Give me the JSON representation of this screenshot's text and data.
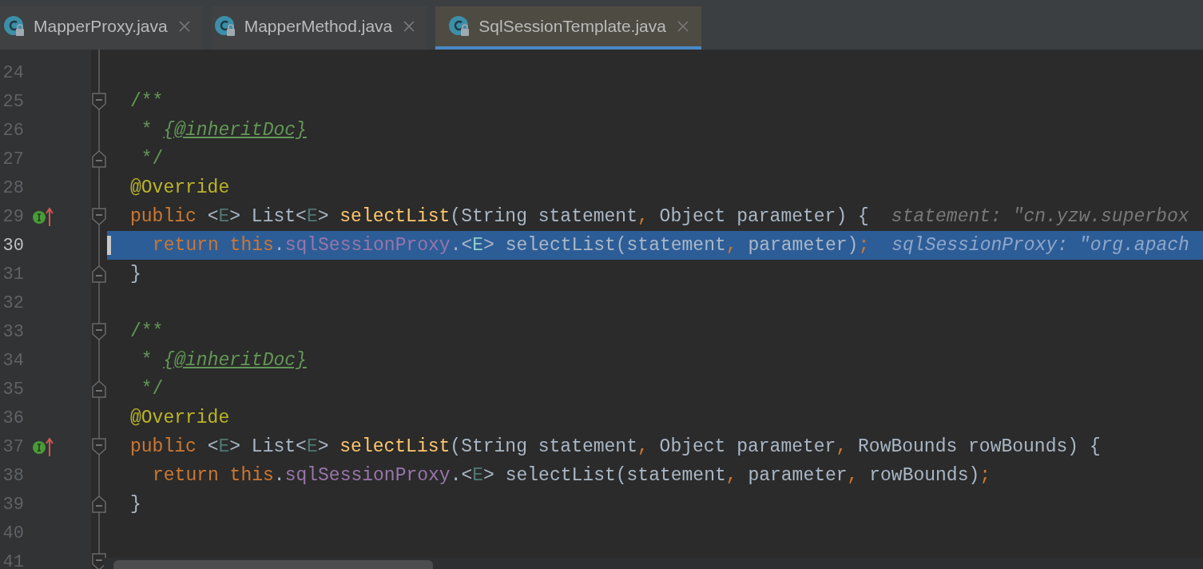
{
  "tabs": [
    {
      "label": "MapperProxy.java",
      "selected": false
    },
    {
      "label": "MapperMethod.java",
      "selected": false
    },
    {
      "label": "SqlSessionTemplate.java",
      "selected": true
    }
  ],
  "lines": [
    {
      "number": "24",
      "current": false,
      "overrides": false
    },
    {
      "number": "25",
      "current": false,
      "overrides": false,
      "fold": {
        "kind": "start"
      },
      "tokens": [
        {
          "kind": "comment",
          "text": "/**"
        }
      ]
    },
    {
      "number": "26",
      "current": false,
      "overrides": false,
      "tokens": [
        {
          "kind": "comment",
          "text": " * "
        },
        {
          "kind": "doc_tag",
          "text": "{@inheritDoc}"
        }
      ]
    },
    {
      "number": "27",
      "current": false,
      "overrides": false,
      "fold": {
        "kind": "end"
      },
      "tokens": [
        {
          "kind": "comment",
          "text": " */"
        }
      ]
    },
    {
      "number": "28",
      "current": false,
      "overrides": false,
      "tokens": [
        {
          "kind": "annotation",
          "text": "@Override"
        }
      ]
    },
    {
      "number": "29",
      "current": false,
      "overrides": true,
      "fold": {
        "kind": "start"
      },
      "tokens": [
        {
          "kind": "keyword",
          "text": "public"
        },
        {
          "kind": "plain",
          "text": " <"
        },
        {
          "kind": "type_param",
          "text": "E"
        },
        {
          "kind": "plain",
          "text": "> List<"
        },
        {
          "kind": "type_param",
          "text": "E"
        },
        {
          "kind": "plain",
          "text": "> "
        },
        {
          "kind": "method",
          "text": "selectList"
        },
        {
          "kind": "plain",
          "text": "(String statement"
        },
        {
          "kind": "keyword",
          "text": ","
        },
        {
          "kind": "plain",
          "text": " Object parameter) {"
        }
      ],
      "hint": "statement: \"cn.yzw.superbox"
    },
    {
      "number": "30",
      "current": true,
      "overrides": false,
      "indented": true,
      "tokens": [
        {
          "kind": "keyword",
          "text": "return this"
        },
        {
          "kind": "plain",
          "text": "."
        },
        {
          "kind": "field",
          "text": "sqlSessionProxy"
        },
        {
          "kind": "plain",
          "text": ".<"
        },
        {
          "kind": "type_param",
          "text": "E"
        },
        {
          "kind": "plain",
          "text": "> selectList(statement"
        },
        {
          "kind": "keyword",
          "text": ","
        },
        {
          "kind": "plain",
          "text": " parameter)"
        },
        {
          "kind": "keyword",
          "text": ";"
        }
      ],
      "hint": "sqlSessionProxy: \"org.apach"
    },
    {
      "number": "31",
      "current": false,
      "overrides": false,
      "fold": {
        "kind": "end"
      },
      "tokens": [
        {
          "kind": "plain",
          "text": "}"
        }
      ]
    },
    {
      "number": "32",
      "current": false,
      "overrides": false
    },
    {
      "number": "33",
      "current": false,
      "overrides": false,
      "fold": {
        "kind": "start"
      },
      "tokens": [
        {
          "kind": "comment",
          "text": "/**"
        }
      ]
    },
    {
      "number": "34",
      "current": false,
      "overrides": false,
      "tokens": [
        {
          "kind": "comment",
          "text": " * "
        },
        {
          "kind": "doc_tag",
          "text": "{@inheritDoc}"
        }
      ]
    },
    {
      "number": "35",
      "current": false,
      "overrides": false,
      "fold": {
        "kind": "end"
      },
      "tokens": [
        {
          "kind": "comment",
          "text": " */"
        }
      ]
    },
    {
      "number": "36",
      "current": false,
      "overrides": false,
      "tokens": [
        {
          "kind": "annotation",
          "text": "@Override"
        }
      ]
    },
    {
      "number": "37",
      "current": false,
      "overrides": true,
      "fold": {
        "kind": "start"
      },
      "tokens": [
        {
          "kind": "keyword",
          "text": "public"
        },
        {
          "kind": "plain",
          "text": " <"
        },
        {
          "kind": "type_param",
          "text": "E"
        },
        {
          "kind": "plain",
          "text": "> List<"
        },
        {
          "kind": "type_param",
          "text": "E"
        },
        {
          "kind": "plain",
          "text": "> "
        },
        {
          "kind": "method",
          "text": "selectList"
        },
        {
          "kind": "plain",
          "text": "(String statement"
        },
        {
          "kind": "keyword",
          "text": ","
        },
        {
          "kind": "plain",
          "text": " Object parameter"
        },
        {
          "kind": "keyword",
          "text": ","
        },
        {
          "kind": "plain",
          "text": " RowBounds rowBounds) {"
        }
      ]
    },
    {
      "number": "38",
      "current": false,
      "overrides": false,
      "indented": true,
      "tokens": [
        {
          "kind": "keyword",
          "text": "return this"
        },
        {
          "kind": "plain",
          "text": "."
        },
        {
          "kind": "field",
          "text": "sqlSessionProxy"
        },
        {
          "kind": "plain",
          "text": ".<"
        },
        {
          "kind": "type_param",
          "text": "E"
        },
        {
          "kind": "plain",
          "text": "> selectList(statement"
        },
        {
          "kind": "keyword",
          "text": ","
        },
        {
          "kind": "plain",
          "text": " parameter"
        },
        {
          "kind": "keyword",
          "text": ","
        },
        {
          "kind": "plain",
          "text": " rowBounds)"
        },
        {
          "kind": "keyword",
          "text": ";"
        }
      ]
    },
    {
      "number": "39",
      "current": false,
      "overrides": false,
      "fold": {
        "kind": "end"
      },
      "tokens": [
        {
          "kind": "plain",
          "text": "}"
        }
      ]
    },
    {
      "number": "40",
      "current": false,
      "overrides": false
    },
    {
      "number": "41",
      "current": false,
      "overrides": false,
      "fold": {
        "kind": "start"
      }
    }
  ]
}
